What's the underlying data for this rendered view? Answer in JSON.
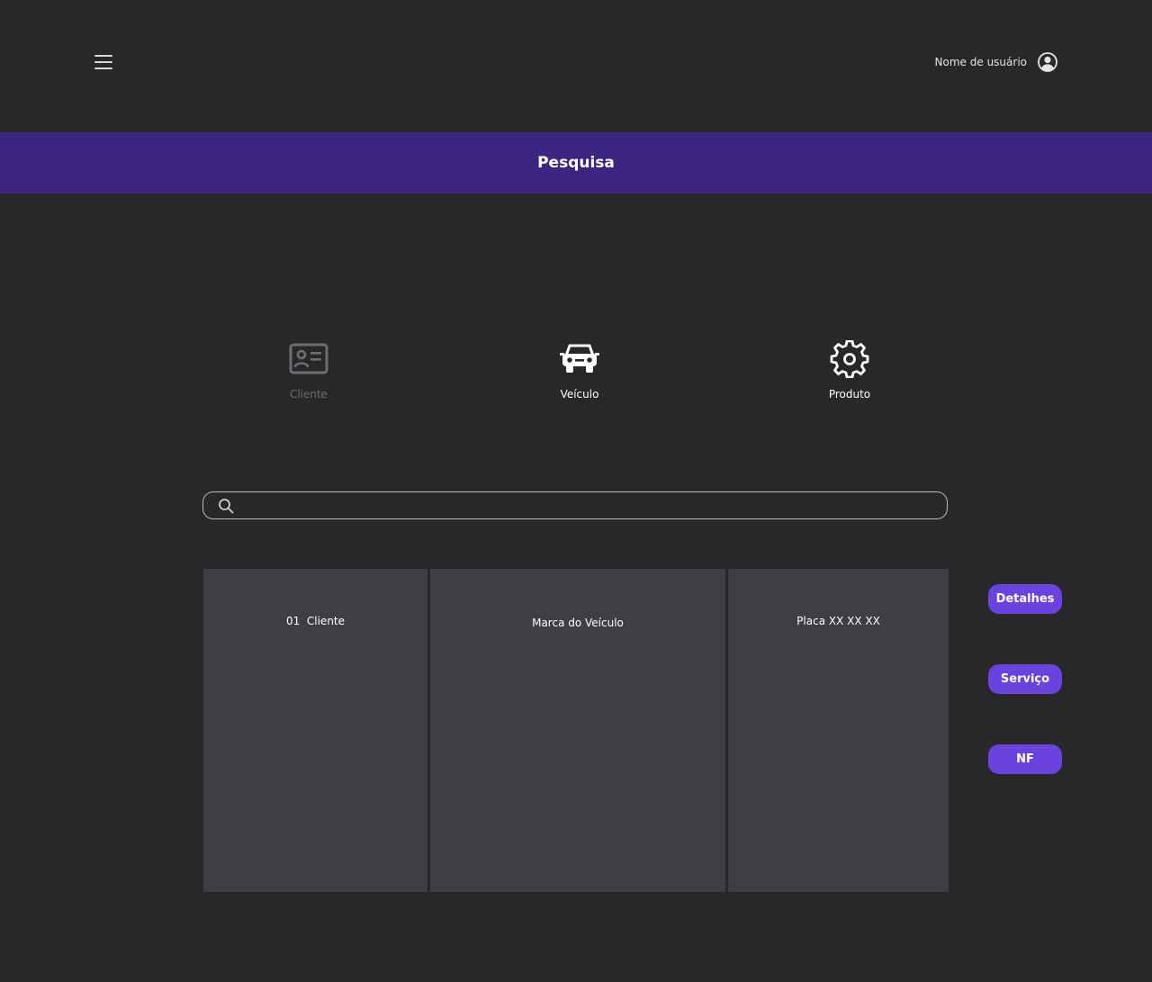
{
  "header": {
    "menu_icon": "hamburger-menu-icon",
    "user_name": "Nome de usuário",
    "user_icon": "user-circle-icon"
  },
  "banner": {
    "title": "Pesquisa",
    "color": "#3d2582"
  },
  "categories": [
    {
      "label": "Cliente",
      "icon": "id-card-icon",
      "active": false
    },
    {
      "label": "Veículo",
      "icon": "car-icon",
      "active": true
    },
    {
      "label": "Produto",
      "icon": "gear-icon",
      "active": true
    }
  ],
  "search": {
    "placeholder": "",
    "value": "",
    "icon": "search-icon"
  },
  "result": {
    "cells": [
      "01  Cliente",
      "Marca do Veículo",
      "Placa XX XX XX"
    ]
  },
  "actions": {
    "details_label": "Detalhes",
    "service_label": "Serviço",
    "invoice_label": "NF",
    "accent_color": "#6a42de"
  }
}
